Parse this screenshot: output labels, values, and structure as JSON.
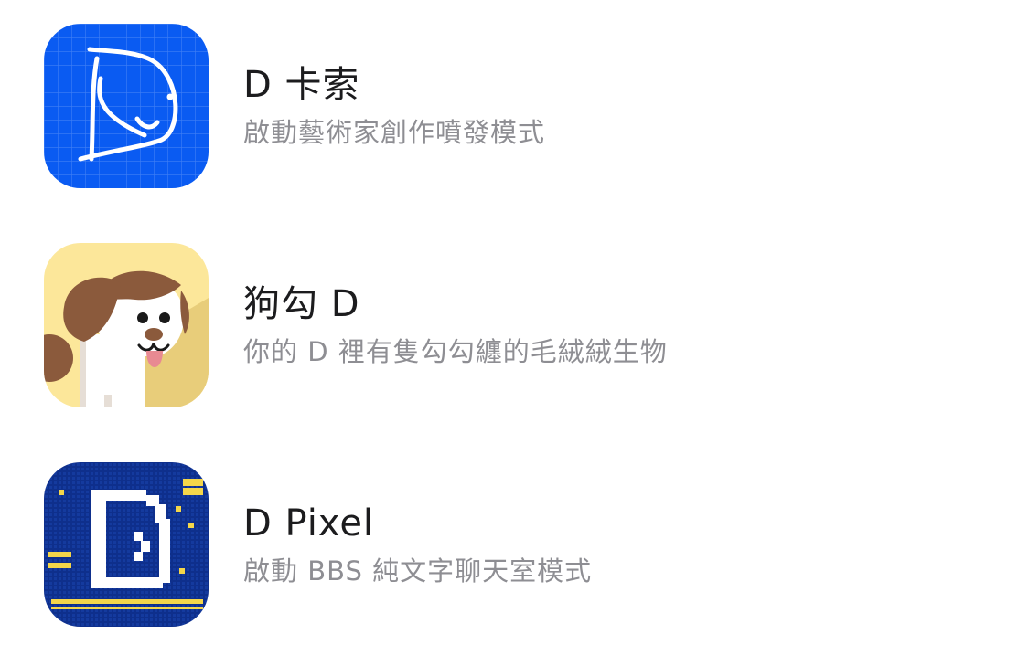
{
  "icons": {
    "items": [
      {
        "title": "D 卡索",
        "subtitle": "啟動藝術家創作噴發模式",
        "icon": "d-picasso-icon",
        "bg": "#0A5BF2"
      },
      {
        "title": "狗勾 D",
        "subtitle": "你的 D 裡有隻勾勾纏的毛絨絨生物",
        "icon": "dog-icon",
        "bg": "#FCE79A"
      },
      {
        "title": "D Pixel",
        "subtitle": "啟動 BBS 純文字聊天室模式",
        "icon": "d-pixel-icon",
        "bg": "#0E2F8C"
      }
    ]
  },
  "colors": {
    "title": "#1c1c1e",
    "subtitle": "#8e8e93",
    "pixel_accent": "#F4D64A"
  }
}
